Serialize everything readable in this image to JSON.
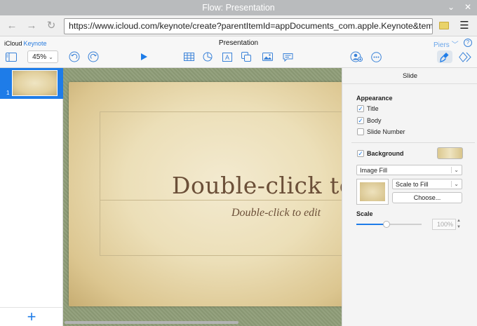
{
  "window": {
    "title": "Flow: Presentation",
    "controls": [
      "minimize",
      "close"
    ]
  },
  "browser": {
    "url": "https://www.icloud.com/keynote/create?parentItemId=appDocuments_com.apple.Keynote&templateId=",
    "buttons": [
      "back-icon",
      "forward-icon",
      "reload-icon",
      "folder-icon",
      "menu-icon"
    ]
  },
  "app": {
    "brand_icloud": "iCloud",
    "brand_app": "Keynote",
    "document_title": "Presentation",
    "user_name": "Piers",
    "user_chevron": "﹀",
    "help": "?"
  },
  "toolbar": {
    "zoom_value": "45%",
    "zoom_chevron": "⌄",
    "icons": [
      "slide-navigator-icon",
      "undo-icon",
      "redo-icon",
      "play-icon",
      "table-icon",
      "chart-icon",
      "text-box-icon",
      "shape-icon",
      "image-icon",
      "comment-icon",
      "collaborate-icon",
      "more-icon",
      "format-icon",
      "animate-icon"
    ],
    "active_icon": "format-icon",
    "accent": "#1e7ce8"
  },
  "navigator": {
    "slides": [
      {
        "number": "1"
      }
    ],
    "add_label": "+"
  },
  "slide": {
    "title_text": "Double-click to",
    "body_text": "Double-click to edit",
    "text_color": "#6b4f38",
    "backdrop_color": "#8f9d78"
  },
  "inspector": {
    "header": "Slide",
    "appearance_label": "Appearance",
    "options": [
      {
        "label": "Title",
        "checked": true
      },
      {
        "label": "Body",
        "checked": true
      },
      {
        "label": "Slide Number",
        "checked": false
      }
    ],
    "background": {
      "label": "Background",
      "checked": true
    },
    "fill_type": "Image Fill",
    "fill_mode": "Scale to Fill",
    "choose_label": "Choose...",
    "scale_label": "Scale",
    "scale_value": "100%",
    "scale_slider_fraction": 0.46
  }
}
